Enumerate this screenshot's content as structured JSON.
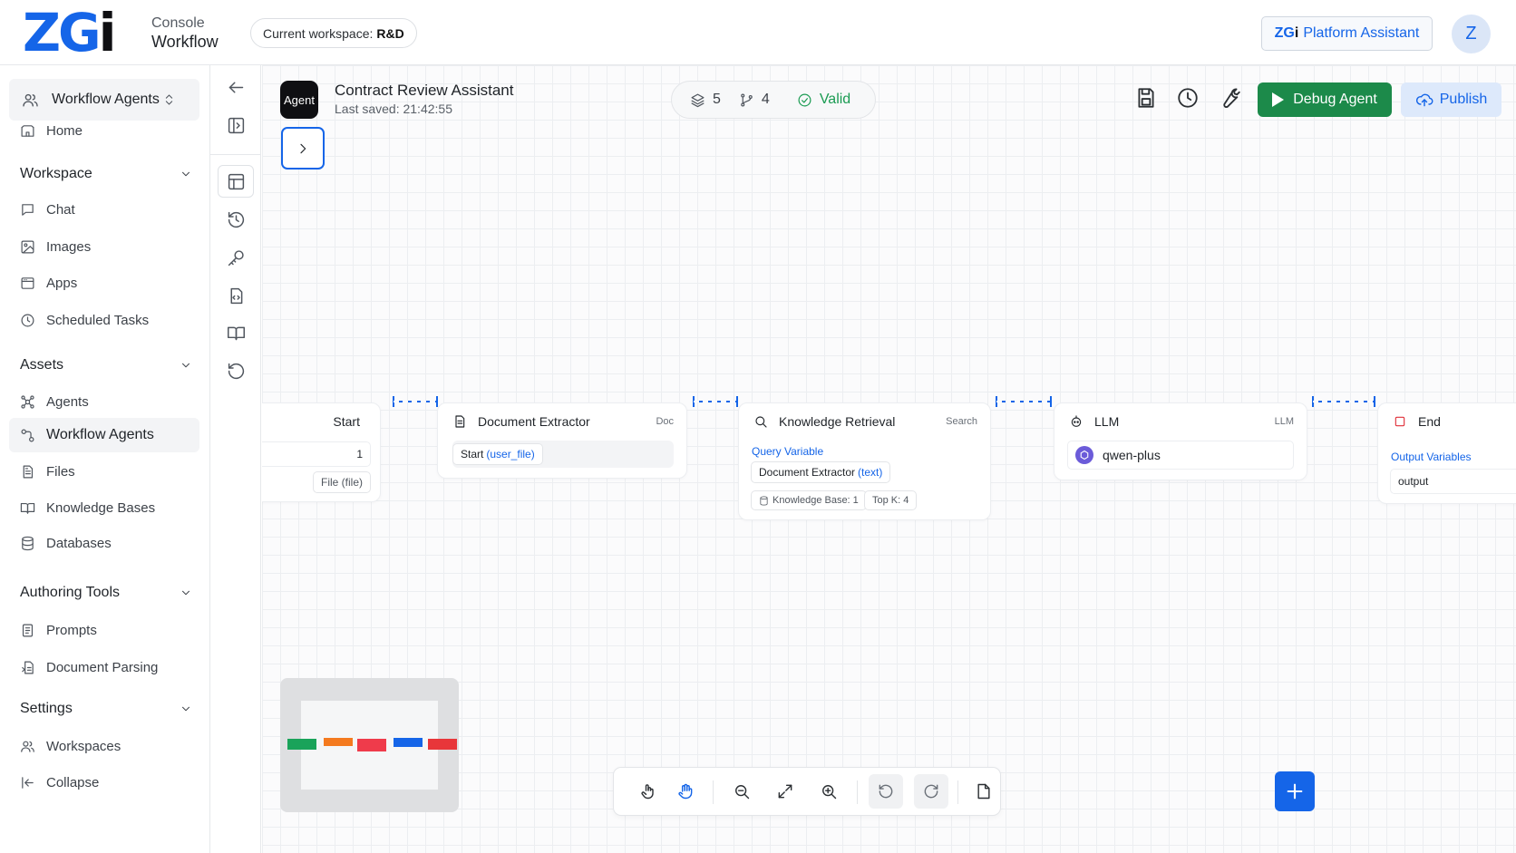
{
  "header": {
    "logo_zg": "ZG",
    "logo_i": "i",
    "console_label": "Console",
    "section_label": "Workflow",
    "workspace_prefix": "Current workspace:",
    "workspace_name": "R&D",
    "assistant_brand_zg": "ZG",
    "assistant_brand_i": "i",
    "assistant_label": "Platform Assistant",
    "avatar_initial": "Z"
  },
  "sidebar": {
    "switcher_label": "Workflow Agents",
    "home": "Home",
    "sections": [
      {
        "label": "Workspace",
        "items": [
          "Chat",
          "Images",
          "Apps",
          "Scheduled Tasks"
        ]
      },
      {
        "label": "Assets",
        "items": [
          "Agents",
          "Workflow Agents",
          "Files",
          "Knowledge Bases",
          "Databases"
        ]
      },
      {
        "label": "Authoring Tools",
        "items": [
          "Prompts",
          "Document Parsing"
        ]
      },
      {
        "label": "Settings",
        "items": [
          "Workspaces"
        ]
      }
    ],
    "collapse": "Collapse",
    "active_item": "Workflow Agents"
  },
  "editor": {
    "badge": "Agent",
    "title": "Contract Review Assistant",
    "last_saved": "Last saved: 21:42:55",
    "stats": {
      "nodes": "5",
      "edges": "4",
      "status": "Valid"
    },
    "debug_label": "Debug Agent",
    "publish_label": "Publish"
  },
  "nodes": {
    "start": {
      "title": "Start",
      "value": "1",
      "field": "File (file)"
    },
    "doc": {
      "title": "Document Extractor",
      "type": "Doc",
      "input_name": "Start",
      "input_var": "(user_file)"
    },
    "kr": {
      "title": "Knowledge Retrieval",
      "type": "Search",
      "query_label": "Query Variable",
      "query_name": "Document Extractor",
      "query_var": "(text)",
      "kb": "Knowledge Base: 1",
      "topk": "Top K: 4"
    },
    "llm": {
      "title": "LLM",
      "type": "LLM",
      "model": "qwen-plus"
    },
    "end": {
      "title": "End",
      "output_label": "Output Variables",
      "output_value": "output"
    }
  },
  "colors": {
    "brand_blue": "#1565e8",
    "debug_green": "#1c8a4a",
    "valid_green": "#1a9b52",
    "minimap_blocks": [
      "#1aa35a",
      "#f47a1f",
      "#ef3b4b",
      "#1565e8",
      "#e8363a"
    ]
  },
  "icons": {
    "toolbar": [
      "pointer-hand-icon",
      "pan-hand-icon",
      "zoom-out-icon",
      "fit-view-icon",
      "zoom-in-icon",
      "undo-icon",
      "redo-icon",
      "note-icon",
      "add-node-icon"
    ],
    "rail": [
      "back-arrow-icon",
      "panel-icon",
      "layout-icon",
      "history-icon",
      "key-icon",
      "code-file-icon",
      "book-icon",
      "reset-icon"
    ]
  }
}
